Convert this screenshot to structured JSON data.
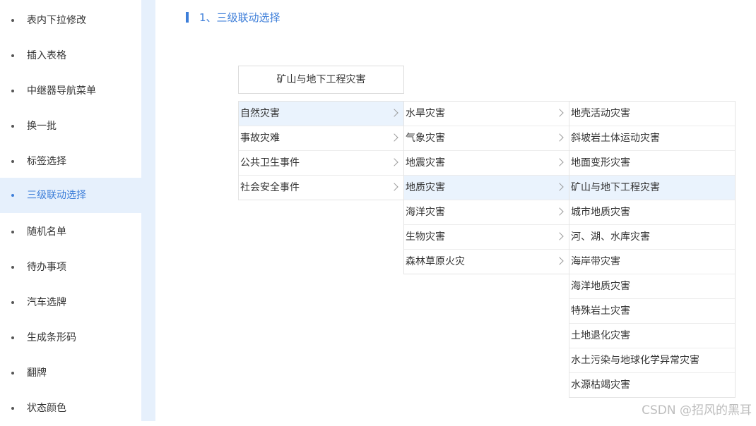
{
  "sidebar": {
    "items": [
      {
        "label": "表内下拉修改"
      },
      {
        "label": "插入表格"
      },
      {
        "label": "中继器导航菜单"
      },
      {
        "label": "换一批"
      },
      {
        "label": "标签选择"
      },
      {
        "label": "三级联动选择",
        "active": true
      },
      {
        "label": "随机名单"
      },
      {
        "label": "待办事项"
      },
      {
        "label": "汽车选牌"
      },
      {
        "label": "生成条形码"
      },
      {
        "label": "翻牌"
      },
      {
        "label": "状态颜色"
      }
    ]
  },
  "section": {
    "title": "1、三级联动选择"
  },
  "selector": {
    "value": "矿山与地下工程灾害"
  },
  "cascader": {
    "level1": [
      "自然灾害",
      "事故灾难",
      "公共卫生事件",
      "社会安全事件"
    ],
    "level1_selected": "自然灾害",
    "level2": [
      "水旱灾害",
      "气象灾害",
      "地震灾害",
      "地质灾害",
      "海洋灾害",
      "生物灾害",
      "森林草原火灾"
    ],
    "level2_selected": "地质灾害",
    "level3": [
      "地壳活动灾害",
      "斜坡岩土体运动灾害",
      "地面变形灾害",
      "矿山与地下工程灾害",
      "城市地质灾害",
      "河、湖、水库灾害",
      "海岸带灾害",
      "海洋地质灾害",
      "特殊岩土灾害",
      "土地退化灾害",
      "水土污染与地球化学异常灾害",
      "水源枯竭灾害"
    ],
    "level3_selected": "矿山与地下工程灾害"
  },
  "watermark": "CSDN @招风的黑耳",
  "colors": {
    "accent": "#3d7ed9",
    "highlight_bg": "#eaf3fd",
    "sidebar_active_bg": "#e6f0fc"
  }
}
